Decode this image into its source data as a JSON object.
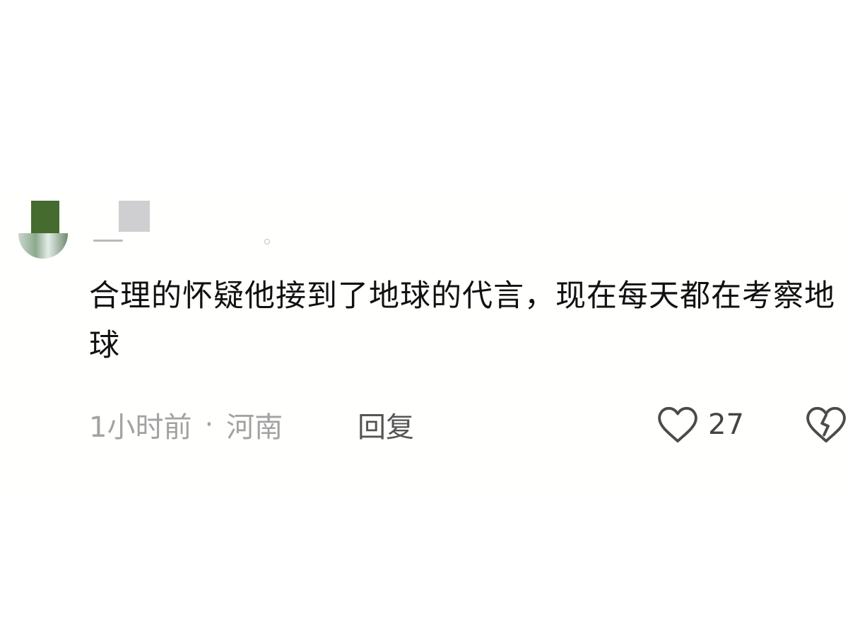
{
  "comment": {
    "text": "合理的怀疑他接到了地球的代言，现在每天都在考察地球",
    "time": "1小时前",
    "separator": "·",
    "location": "河南",
    "reply_label": "回复",
    "like_count": "27"
  },
  "icons": {
    "avatar": "avatar",
    "like": "heart-icon",
    "dislike": "broken-heart-icon"
  },
  "colors": {
    "text": "#111111",
    "meta": "#a2a2a2",
    "icon": "#4b4b4b"
  }
}
